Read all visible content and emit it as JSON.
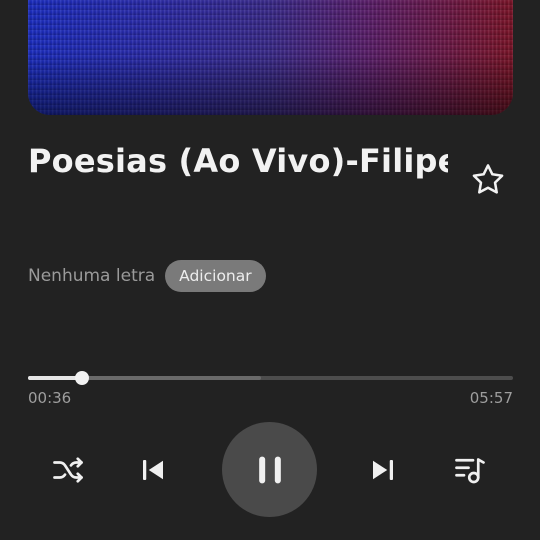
{
  "track": {
    "title": "Poesias (Ao Vivo)-Filipe..",
    "favorite_icon": "star-outline-icon"
  },
  "lyrics": {
    "status_text": "Nenhuma letra",
    "add_label": "Adicionar"
  },
  "progress": {
    "elapsed": "00:36",
    "total": "05:57",
    "played_fraction": 0.112,
    "buffered_fraction": 0.48
  },
  "controls": {
    "shuffle_icon": "shuffle-icon",
    "previous_icon": "skip-previous-icon",
    "play_pause_icon": "pause-icon",
    "next_icon": "skip-next-icon",
    "queue_icon": "playlist-music-icon"
  },
  "colors": {
    "background": "#222222",
    "title": "#f2f2f2",
    "secondary_text": "#9a9a9a",
    "chip": "#7a7a7a",
    "progress_played": "#e6e6e6",
    "play_button": "#4a4a4a"
  }
}
